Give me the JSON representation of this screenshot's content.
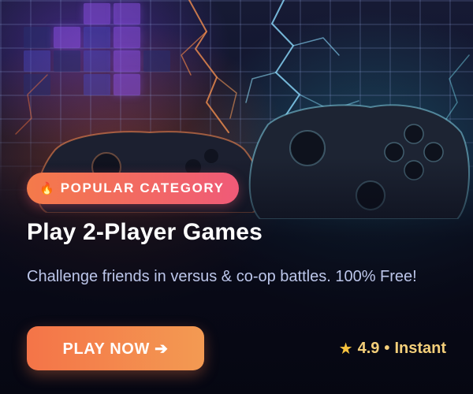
{
  "promo": {
    "badge": {
      "icon": "fire-icon",
      "icon_glyph": "🔥",
      "label": "POPULAR CATEGORY"
    },
    "title": "Play 2-Player Games",
    "subtitle": "Challenge friends in versus & co-op battles. 100% Free!",
    "cta_label": "PLAY NOW ➔",
    "rating": {
      "icon": "star-icon",
      "icon_glyph": "★",
      "value": "4.9",
      "separator": "•",
      "speed": "Instant"
    }
  },
  "colors": {
    "badge_gradient": [
      "#f47a4a",
      "#f05a78"
    ],
    "cta_gradient": [
      "#f47448",
      "#f39a52"
    ],
    "rating_text": "#f4cf7a",
    "subtitle_text": "#bcc6ea",
    "background": "#0c0e1f"
  }
}
